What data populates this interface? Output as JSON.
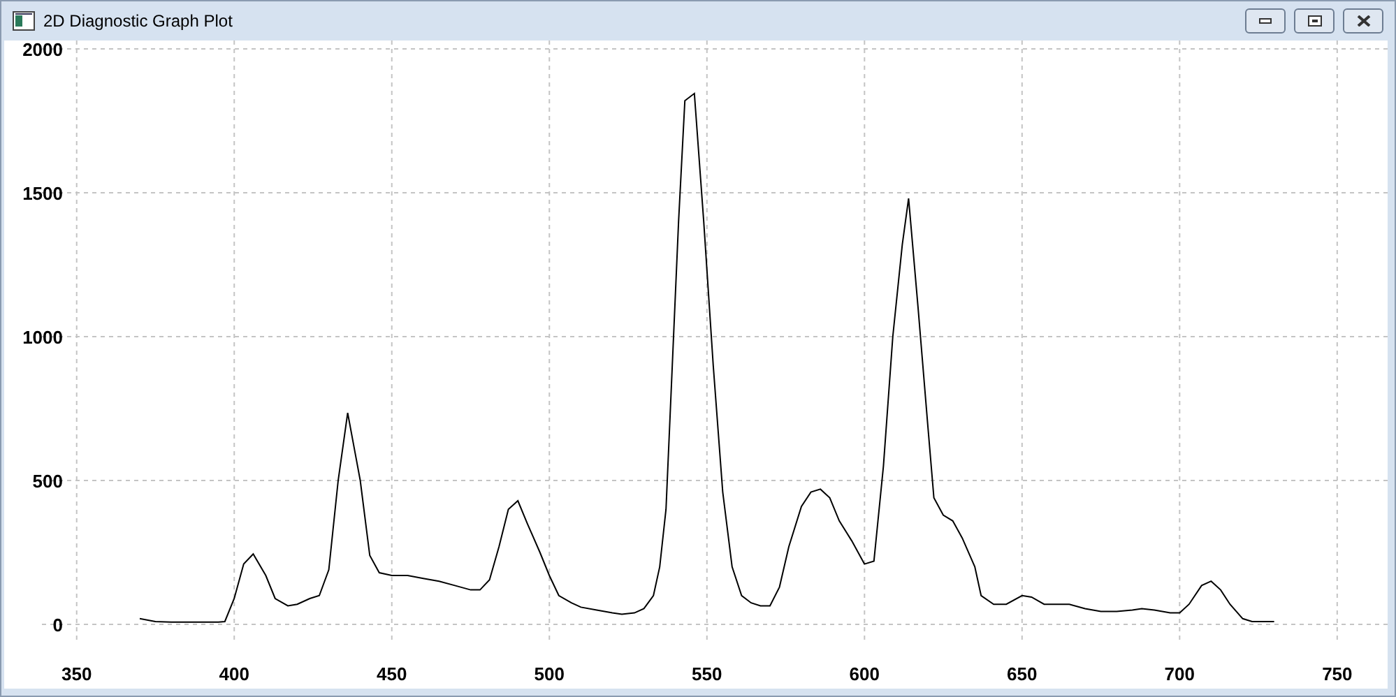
{
  "window": {
    "title": "2D Diagnostic Graph Plot"
  },
  "plot": {
    "chart_data": {
      "type": "line",
      "grid": true,
      "xlim": [
        327,
        766
      ],
      "ylim": [
        -223,
        2029
      ],
      "xticks": [
        350,
        400,
        450,
        500,
        550,
        600,
        650,
        700,
        750
      ],
      "yticks": [
        0,
        500,
        1000,
        1500,
        2000
      ],
      "x": [
        370,
        375,
        380,
        385,
        390,
        395,
        397,
        400,
        403,
        406,
        410,
        413,
        417,
        420,
        424,
        427,
        430,
        433,
        436,
        440,
        443,
        446,
        450,
        455,
        460,
        465,
        470,
        475,
        478,
        481,
        484,
        487,
        490,
        493,
        497,
        500,
        503,
        507,
        510,
        515,
        520,
        523,
        527,
        530,
        533,
        535,
        537,
        539,
        541,
        543,
        546,
        549,
        552,
        555,
        558,
        561,
        564,
        567,
        570,
        573,
        576,
        580,
        583,
        586,
        589,
        592,
        596,
        600,
        603,
        606,
        609,
        612,
        614,
        617,
        620,
        622,
        625,
        628,
        631,
        635,
        637,
        641,
        645,
        650,
        653,
        657,
        661,
        665,
        670,
        675,
        680,
        685,
        688,
        692,
        697,
        700,
        703,
        707,
        710,
        713,
        716,
        720,
        723,
        730
      ],
      "series": [
        {
          "color": "#000000",
          "values": [
            20,
            10,
            8,
            8,
            8,
            8,
            10,
            90,
            210,
            245,
            170,
            90,
            65,
            70,
            90,
            100,
            190,
            500,
            735,
            500,
            240,
            180,
            170,
            170,
            160,
            150,
            135,
            120,
            120,
            155,
            270,
            400,
            430,
            350,
            250,
            170,
            100,
            75,
            60,
            50,
            40,
            35,
            40,
            55,
            100,
            200,
            400,
            900,
            1400,
            1820,
            1845,
            1400,
            900,
            460,
            200,
            100,
            75,
            65,
            65,
            130,
            270,
            410,
            460,
            470,
            440,
            360,
            290,
            210,
            220,
            550,
            1000,
            1320,
            1480,
            1100,
            700,
            440,
            380,
            360,
            300,
            200,
            100,
            70,
            70,
            100,
            95,
            70,
            70,
            70,
            55,
            45,
            45,
            50,
            55,
            50,
            40,
            40,
            70,
            135,
            150,
            120,
            70,
            20,
            10,
            10
          ]
        }
      ]
    }
  }
}
